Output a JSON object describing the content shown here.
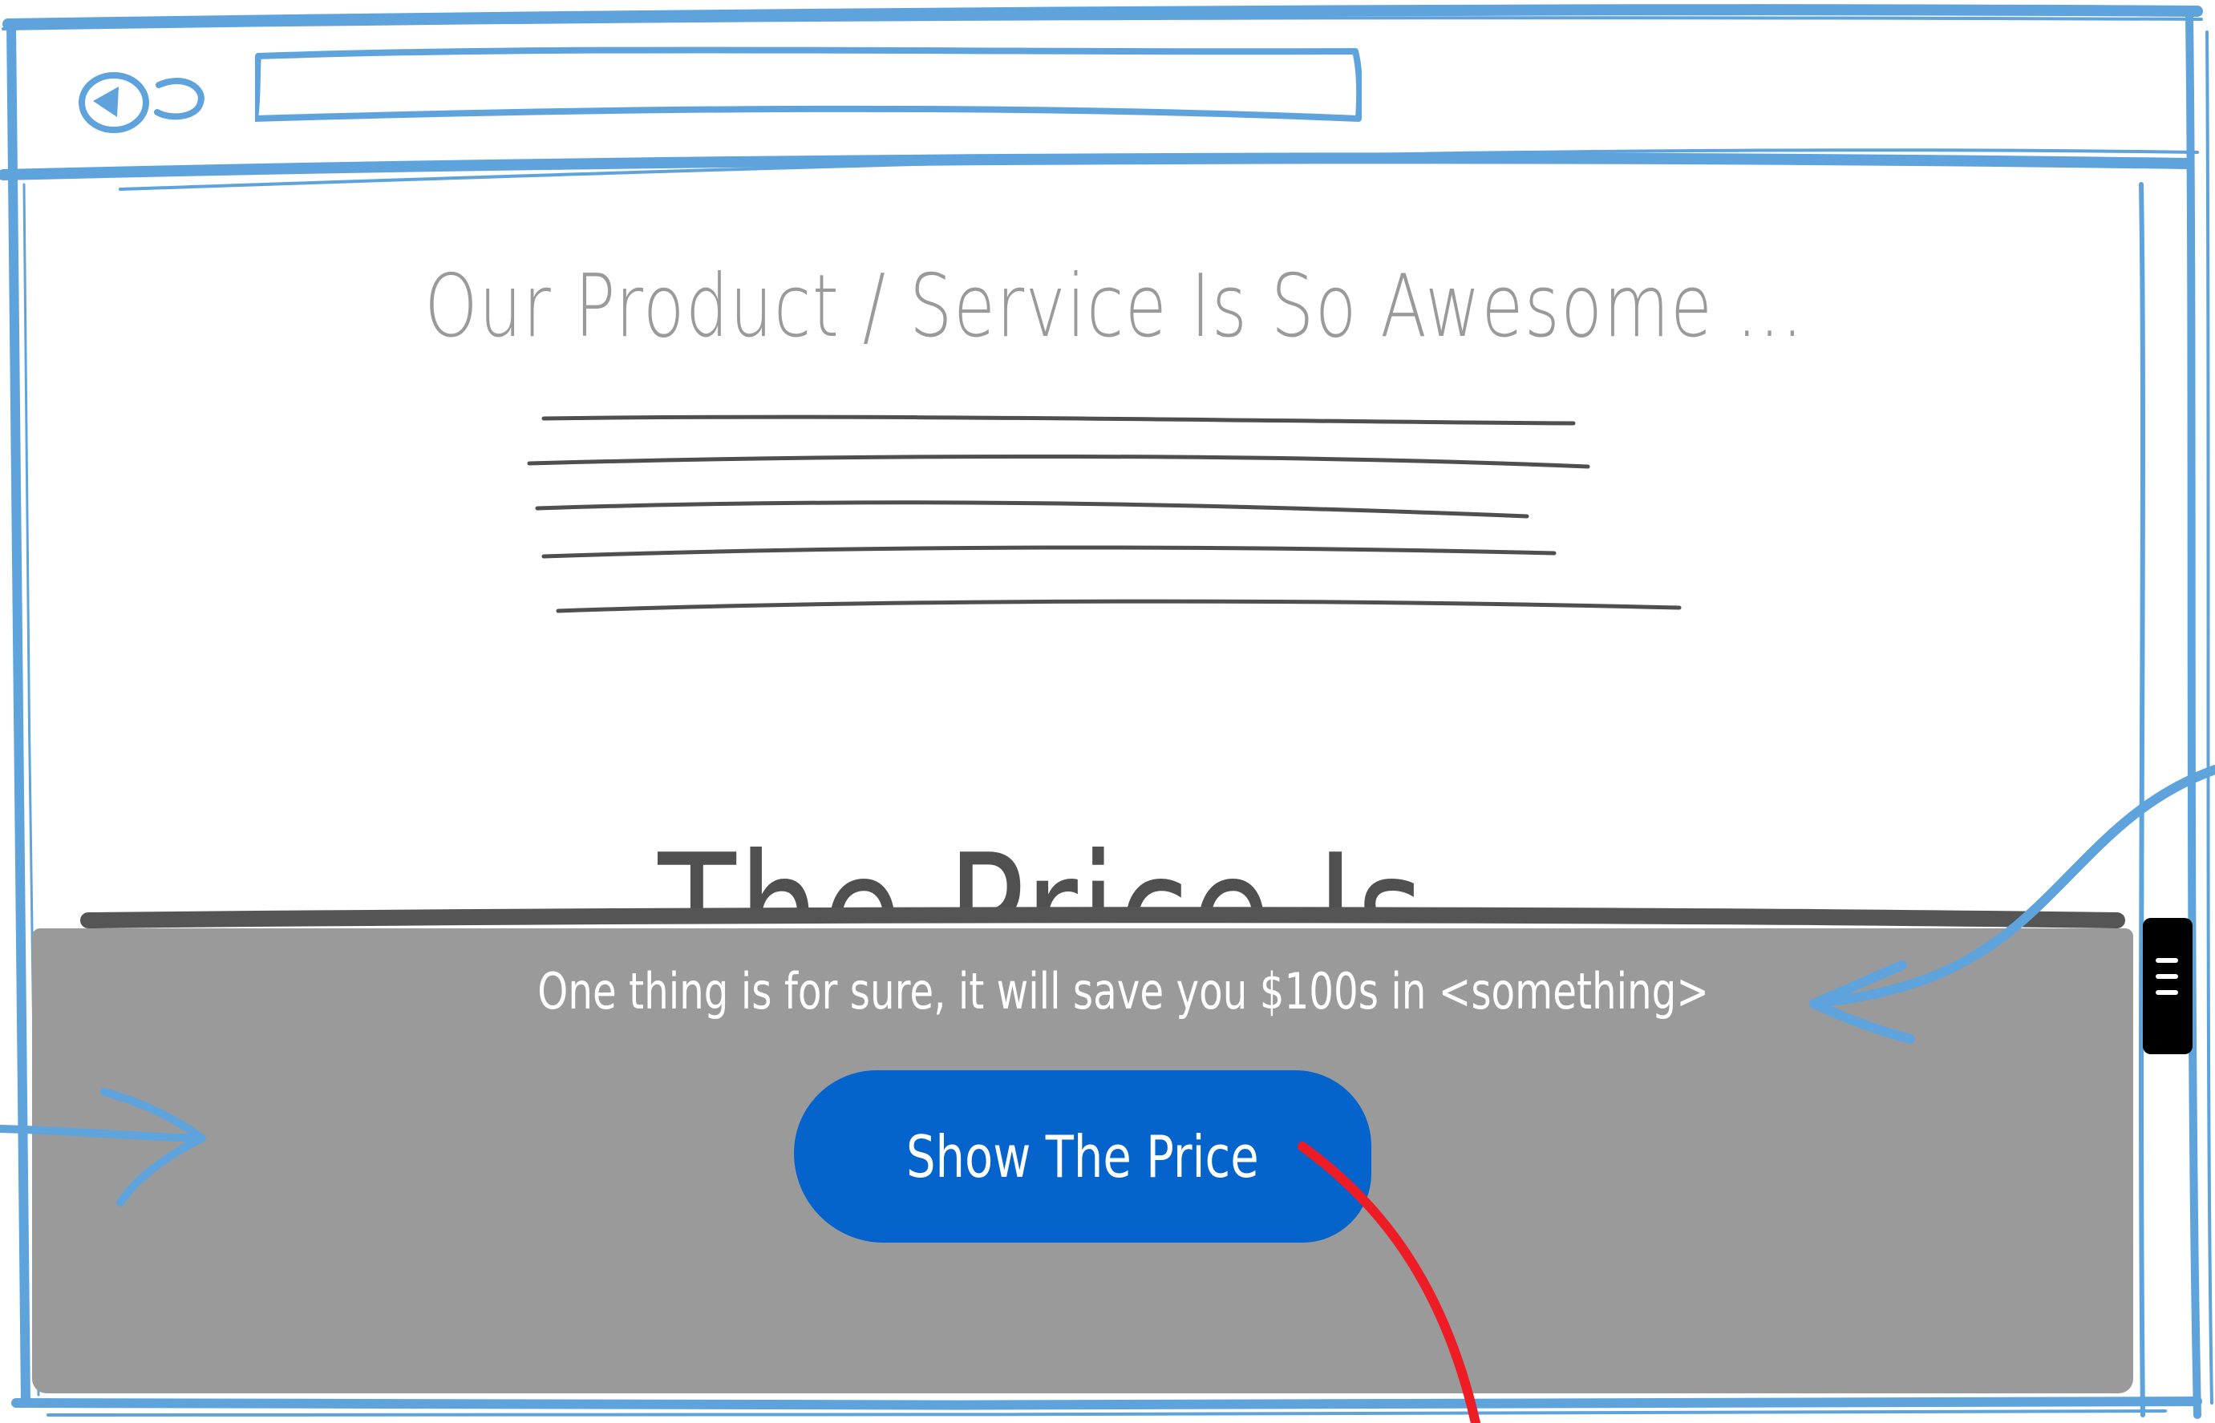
{
  "browser": {
    "address_value": "",
    "back_icon": "back-arrow-icon",
    "forward_icon": "forward-icon"
  },
  "page": {
    "headline": "Our Product / Service Is So Awesome ...",
    "price_heading": "The Price Is"
  },
  "banner": {
    "message": "One thing is for sure, it will save you $100s in <something>",
    "button_label": "Show The Price",
    "handle_icon": "drag-handle-icon"
  },
  "colors": {
    "sketch_blue": "#5fa3dc",
    "banner_gray": "#9a9a9a",
    "button_blue": "#0563cc",
    "arrow_red": "#ee1c25",
    "text_dark": "#505050"
  }
}
